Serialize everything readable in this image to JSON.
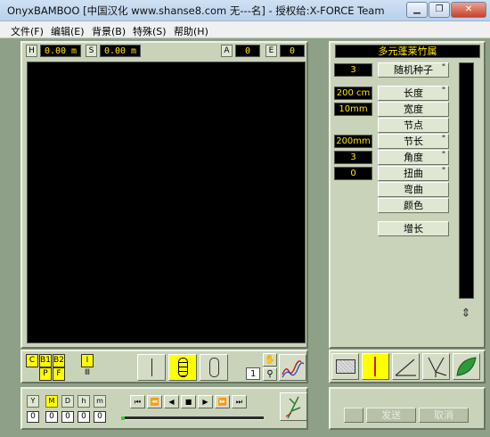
{
  "window": {
    "title": "OnyxBAMBOO [中国汉化 www.shanse8.com 无---名] - 授权给:X-FORCE Team",
    "min_glyph": "▁",
    "max_glyph": "❐",
    "close_glyph": "✕"
  },
  "menu": [
    {
      "label": "文件(F)"
    },
    {
      "label": "编辑(E)"
    },
    {
      "label": "背景(B)"
    },
    {
      "label": "特殊(S)"
    },
    {
      "label": "帮助(H)"
    }
  ],
  "readouts": {
    "h_tag": "H",
    "h_value": "0.00 m",
    "s_tag": "S",
    "s_value": "0.00 m",
    "a_tag": "A",
    "a_value": "0",
    "e_tag": "E",
    "e_value": "0"
  },
  "species_name": "多元蓬莱竹属",
  "seed": {
    "value": "3",
    "label": "随机种子",
    "help": "\""
  },
  "props": [
    {
      "label": "长度",
      "value": "200 cm",
      "help": "\""
    },
    {
      "label": "宽度",
      "value": "10mm",
      "help": ""
    },
    {
      "label": "节点",
      "value": "",
      "help": ""
    },
    {
      "label": "节长",
      "value": "200mm",
      "help": "\""
    },
    {
      "label": "角度",
      "value": "3",
      "help": "\""
    },
    {
      "label": "扭曲",
      "value": "0",
      "help": "\""
    },
    {
      "label": "弯曲",
      "value": "",
      "help": ""
    },
    {
      "label": "颜色",
      "value": "",
      "help": ""
    }
  ],
  "grow_label": "增长",
  "view_toggles": [
    "C",
    "B1",
    "B2",
    "P",
    "F"
  ],
  "i_toggle": "I",
  "counter": "1",
  "time_tabs": [
    "Y",
    "M",
    "D",
    "h",
    "m"
  ],
  "time_values": [
    "0",
    "0",
    "0",
    "0",
    "0"
  ],
  "transport": [
    "⏮",
    "⏪",
    "◀",
    "■",
    "▶",
    "⏩",
    "⏭"
  ],
  "footer": {
    "send": "发送",
    "cancel": "取消"
  },
  "colors": {
    "lcd_text": "#ffe600",
    "toggle_on": "#ffff00",
    "panel": "#c9d3b9"
  }
}
